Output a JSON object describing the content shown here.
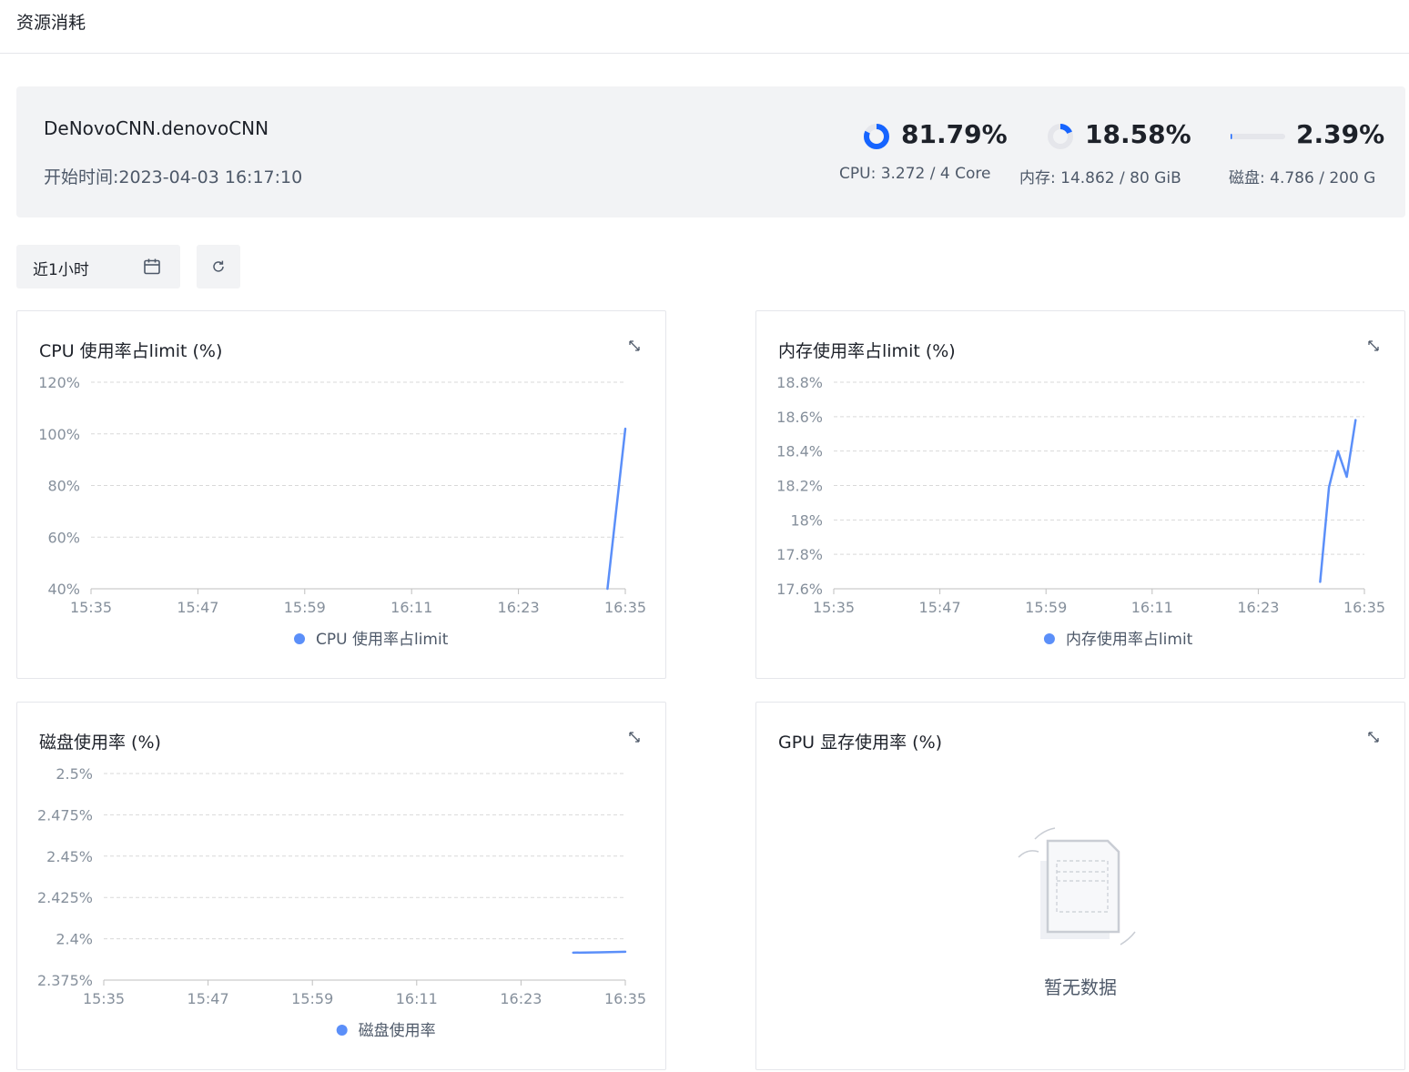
{
  "page": {
    "title": "资源消耗"
  },
  "summary": {
    "job_name": "DeNovoCNN.denovoCNN",
    "start_time": "开始时间:2023-04-03 16:17:10",
    "stats": [
      {
        "name": "cpu",
        "value": "81.79%",
        "fraction": 0.8179,
        "detail": "CPU: 3.272 / 4 Core",
        "indicator": "ring"
      },
      {
        "name": "memory",
        "value": "18.58%",
        "fraction": 0.1858,
        "detail": "内存: 14.862 / 80 GiB",
        "indicator": "ring"
      },
      {
        "name": "disk",
        "value": "2.39%",
        "fraction": 0.0239,
        "detail": "磁盘: 4.786 / 200 G",
        "indicator": "bar"
      }
    ],
    "colors": {
      "accent": "#1664ff",
      "track": "#e5e6eb"
    }
  },
  "toolbar": {
    "range_label": "近1小时",
    "calendar_icon": "calendar-icon",
    "refresh_icon": "refresh-icon"
  },
  "empty_state": {
    "text": "暂无数据",
    "icon": "empty-document-icon"
  },
  "chart_data": [
    {
      "id": "cpu",
      "type": "line",
      "title": "CPU 使用率占limit (%)",
      "x_ticks": [
        "15:35",
        "15:47",
        "15:59",
        "16:11",
        "16:23",
        "16:35"
      ],
      "y_ticks": [
        "40%",
        "60%",
        "80%",
        "100%",
        "120%"
      ],
      "ylim": [
        40,
        120
      ],
      "series": [
        {
          "name": "CPU 使用率占limit",
          "color": "#5b8ff9",
          "points": [
            {
              "x": "16:33",
              "y": 40
            },
            {
              "x": "16:35",
              "y": 102
            }
          ]
        }
      ],
      "grid": true,
      "legend": "bottom"
    },
    {
      "id": "memory",
      "type": "line",
      "title": "内存使用率占limit (%)",
      "x_ticks": [
        "15:35",
        "15:47",
        "15:59",
        "16:11",
        "16:23",
        "16:35"
      ],
      "y_ticks": [
        "17.6%",
        "17.8%",
        "18%",
        "18.2%",
        "18.4%",
        "18.6%",
        "18.8%"
      ],
      "ylim": [
        17.6,
        18.8
      ],
      "series": [
        {
          "name": "内存使用率占limit",
          "color": "#5b8ff9",
          "points": [
            {
              "x": "16:30",
              "y": 17.64
            },
            {
              "x": "16:31",
              "y": 18.19
            },
            {
              "x": "16:32",
              "y": 18.4
            },
            {
              "x": "16:33",
              "y": 18.25
            },
            {
              "x": "16:34",
              "y": 18.58
            }
          ]
        }
      ],
      "grid": true,
      "legend": "bottom"
    },
    {
      "id": "disk",
      "type": "line",
      "title": "磁盘使用率 (%)",
      "x_ticks": [
        "15:35",
        "15:47",
        "15:59",
        "16:11",
        "16:23",
        "16:35"
      ],
      "y_ticks": [
        "2.375%",
        "2.4%",
        "2.425%",
        "2.45%",
        "2.475%",
        "2.5%"
      ],
      "ylim": [
        2.375,
        2.5
      ],
      "series": [
        {
          "name": "磁盘使用率",
          "color": "#5b8ff9",
          "points": [
            {
              "x": "16:29",
              "y": 2.3916
            },
            {
              "x": "16:32",
              "y": 2.3918
            },
            {
              "x": "16:35",
              "y": 2.3921
            }
          ]
        }
      ],
      "grid": true,
      "legend": "bottom"
    },
    {
      "id": "gpu",
      "type": "line",
      "title": "GPU 显存使用率 (%)",
      "series": [],
      "empty": true
    }
  ]
}
